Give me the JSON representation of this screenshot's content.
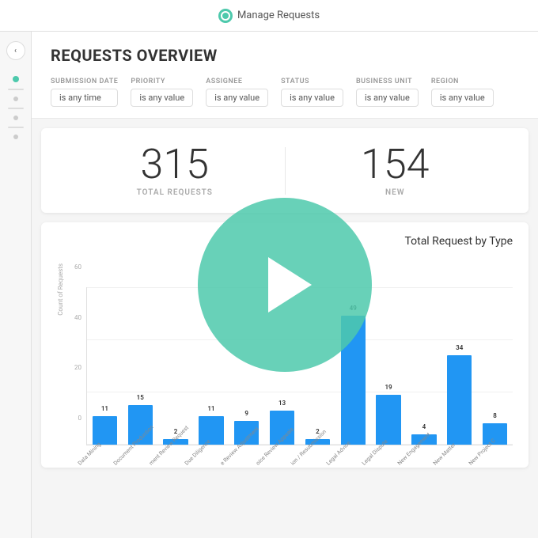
{
  "topbar": {
    "title": "Manage Requests"
  },
  "page": {
    "title": "REQUESTS OVERVIEW"
  },
  "filters": [
    {
      "label": "SUBMISSION DATE",
      "value": "is any time"
    },
    {
      "label": "PRIORITY",
      "value": "is any value"
    },
    {
      "label": "ASSIGNEE",
      "value": "is any value"
    },
    {
      "label": "STATUS",
      "value": "is any value"
    },
    {
      "label": "BUSINESS UNIT",
      "value": "is any value"
    },
    {
      "label": "REGION",
      "value": "is any value"
    }
  ],
  "stats": [
    {
      "number": "315",
      "label": "TOTAL REQUESTS"
    },
    {
      "number": "154",
      "label": "NEW"
    }
  ],
  "chart": {
    "title": "Total Request by Type",
    "y_axis_label": "Count of Requests",
    "y_max": 60,
    "y_ticks": [
      "60",
      "40",
      "20",
      "0"
    ],
    "bars": [
      {
        "label": "Data Mining",
        "value": 11
      },
      {
        "label": "Document Production",
        "value": 15
      },
      {
        "label": "ment Review Request",
        "value": 2
      },
      {
        "label": "Due Diligence",
        "value": 11
      },
      {
        "label": "e Review Adjustment",
        "value": 9
      },
      {
        "label": "oice Review Appeals",
        "value": 13
      },
      {
        "label": "ion / Resubmission",
        "value": 2
      },
      {
        "label": "Legal Advice",
        "value": 49
      },
      {
        "label": "Legal Dispute",
        "value": 19
      },
      {
        "label": "New Engagement",
        "value": 4
      },
      {
        "label": "New Matter",
        "value": 34
      },
      {
        "label": "New Project C",
        "value": 8
      }
    ]
  },
  "sidebar": {
    "back_label": "<"
  },
  "play_button": {
    "aria_label": "Play video"
  }
}
